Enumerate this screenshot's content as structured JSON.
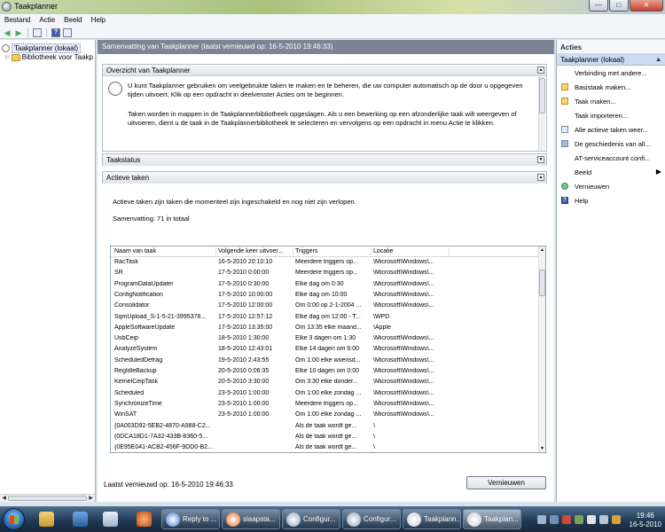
{
  "window": {
    "title": "Taakplanner"
  },
  "menu": [
    "Bestand",
    "Actie",
    "Beeld",
    "Help"
  ],
  "tree": {
    "root": "Taakplanner (lokaal)",
    "child": "Bibliotheek voor Taakp"
  },
  "center": {
    "header": "Samenvatting van Taakplanner (laatst vernieuwd op: 16-5-2010 19:46:33)",
    "overview": {
      "title": "Overzicht van Taakplanner",
      "p1": "U kunt Taakplanner gebruiken om veelgebruikte taken te maken en te beheren, die uw computer automatisch op de door u opgegeven tijden uitvoert. Klik op een opdracht in deelvenster Acties om te beginnen.",
      "p2": "Taken worden in mappen in de Taakplannerbibliotheek opgeslagen. Als u een bewerking op een afzonderlijke taak wilt weergeven of uitvoeren, dient u de taak in de Taakplannerbibliotheek te selecteren en vervolgens op een opdracht in menu Actie te klikken."
    },
    "status_title": "Taakstatus",
    "active": {
      "title": "Actieve taken",
      "desc": "Actieve taken zijn taken die momenteel zijn ingeschakeld en nog niet zijn verlopen.",
      "summary": "Samenvatting: 71 in totaal"
    },
    "table": {
      "headers": [
        "Naam van taak",
        "Volgende keer uitvoer...",
        "Triggers",
        "Locatie"
      ],
      "rows": [
        [
          "RacTask",
          "16-5-2010 20:10:10",
          "Meerdere triggers op...",
          "\\Microsoft\\Windows\\..."
        ],
        [
          "SR",
          "17-5-2010 0:00:00",
          "Meerdere triggers op...",
          "\\Microsoft\\Windows\\..."
        ],
        [
          "ProgramDataUpdater",
          "17-5-2010 0:30:00",
          "Elke dag om 0:30",
          "\\Microsoft\\Windows\\..."
        ],
        [
          "ConfigNotification",
          "17-5-2010 10:00:00",
          "Elke dag om 10:00",
          "\\Microsoft\\Windows\\..."
        ],
        [
          "Consolidator",
          "17-5-2010 12:00:00",
          "Om 0:00 op 2-1-2004 ...",
          "\\Microsoft\\Windows\\..."
        ],
        [
          "SqmUpload_S-1-5-21-3995378...",
          "17-5-2010 12:57:12",
          "Elke dag om 12:00 - T...",
          "\\WPD"
        ],
        [
          "AppleSoftwareUpdate",
          "17-5-2010 13:35:00",
          "Om 13:35 elke maand...",
          "\\Apple"
        ],
        [
          "UsbCeip",
          "18-5-2010 1:30:00",
          "Elke 3 dagen om 1:30",
          "\\Microsoft\\Windows\\..."
        ],
        [
          "AnalyzeSystem",
          "18-5-2010 12:43:01",
          "Elke 14 dagen om 6:00",
          "\\Microsoft\\Windows\\..."
        ],
        [
          "ScheduledDefrag",
          "19-5-2010 2:43:55",
          "Om 1:00 elke woensd...",
          "\\Microsoft\\Windows\\..."
        ],
        [
          "RegIdleBackup",
          "20-5-2010 0:06:35",
          "Elke 10 dagen om 0:00",
          "\\Microsoft\\Windows\\..."
        ],
        [
          "KernelCeipTask",
          "20-5-2010 3:30:00",
          "Om 3:30 elke donder...",
          "\\Microsoft\\Windows\\..."
        ],
        [
          "Scheduled",
          "23-5-2010 1:00:00",
          "Om 1:00 elke zondag ...",
          "\\Microsoft\\Windows\\..."
        ],
        [
          "SynchronizeTime",
          "23-5-2010 1:00:00",
          "Meerdere triggers op...",
          "\\Microsoft\\Windows\\..."
        ],
        [
          "WinSAT",
          "23-5-2010 1:00:00",
          "Om 1:00 elke zondag ...",
          "\\Microsoft\\Windows\\..."
        ],
        [
          "{0A003D92-5EB2-4870-A988-C2...",
          "",
          "Als de taak wordt ge...",
          "\\"
        ],
        [
          "{0DCA18D1-7A32-433B-8360-5...",
          "",
          "Als de taak wordt ge...",
          "\\"
        ],
        [
          "{0E95E041-ACB2-456F-9DD0-B2...",
          "",
          "Als de taak wordt ge...",
          "\\"
        ]
      ]
    },
    "footer": {
      "last_refreshed": "Laatst vernieuwd op: 16-5-2010 19:46:33",
      "refresh_button": "Vernieuwen"
    }
  },
  "actions": {
    "title": "Acties",
    "subheader": "Taakplanner (lokaal)",
    "items": [
      {
        "label": "Verbinding met andere...",
        "icon": "none"
      },
      {
        "label": "Basistaak maken...",
        "icon": "star"
      },
      {
        "label": "Taak maken...",
        "icon": "star"
      },
      {
        "label": "Taak importeren...",
        "icon": "none"
      },
      {
        "label": "Alle actieve taken weer...",
        "icon": "list"
      },
      {
        "label": "De geschiedenis van all...",
        "icon": "hist"
      },
      {
        "label": "AT-serviceaccount confi...",
        "icon": "none"
      },
      {
        "label": "Beeld",
        "icon": "none",
        "submenu": true
      },
      {
        "label": "Vernieuwen",
        "icon": "refresh"
      },
      {
        "label": "Help",
        "icon": "help"
      }
    ]
  },
  "taskbar": {
    "buttons": [
      {
        "label": "Reply to ...",
        "color": "#4a79c9"
      },
      {
        "label": "slaapsta...",
        "color": "#e06a1f"
      },
      {
        "label": "Configur...",
        "color": "#8fa3bd"
      },
      {
        "label": "Configur...",
        "color": "#8fa3bd"
      },
      {
        "label": "Taakplann...",
        "color": "#c9cdd2"
      },
      {
        "label": "Taakplan...",
        "color": "#c9cdd2"
      }
    ],
    "clock_time": "19:46",
    "clock_date": "16-5-2010"
  }
}
